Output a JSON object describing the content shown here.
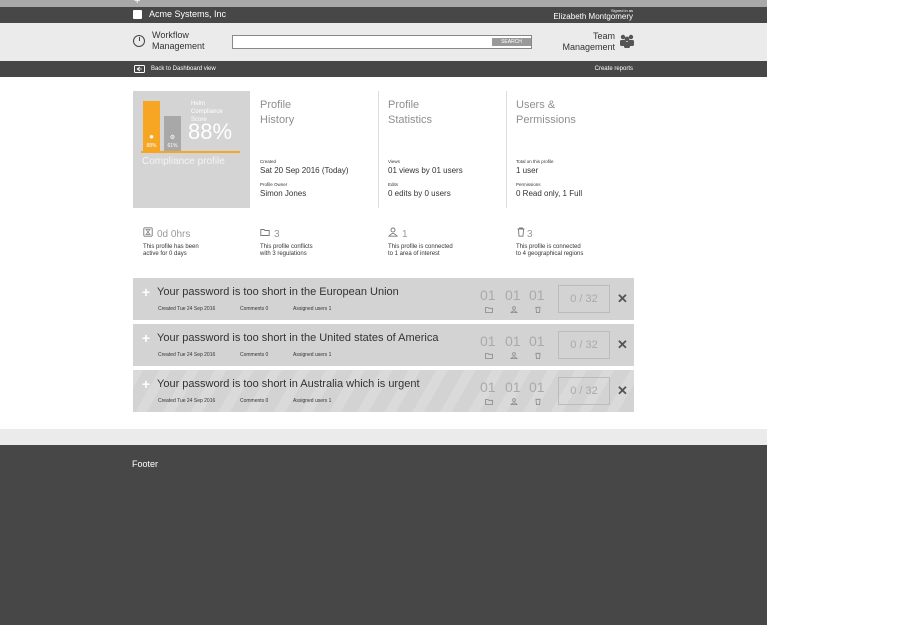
{
  "header": {
    "company": "Acme Systems, Inc",
    "signed_in_label": "Signed in as",
    "user_name": "Elizabeth Montgomery"
  },
  "nav": {
    "workflow_line1": "Workflow",
    "workflow_line2": "Management",
    "search_value": "",
    "search_button": "SEARCH",
    "team_line1": "Team",
    "team_line2": "Management"
  },
  "subnav": {
    "back_label": "Back to Dashboard view",
    "create_label": "Create reports"
  },
  "score": {
    "label": "Helm Compliance Score",
    "value": "88%",
    "bar1_label": "88%",
    "bar1_value": 88,
    "bar2_label": "61%",
    "bar2_value": 61,
    "profile_label": "Compliance profile"
  },
  "columns": [
    {
      "title_line1": "Profile",
      "title_line2": "History",
      "field1_label": "Created",
      "field1_value": "Sat 20 Sep 2016 (Today)",
      "field2_label": "Profile Owner",
      "field2_value": "Simon Jones"
    },
    {
      "title_line1": "Profile",
      "title_line2": "Statistics",
      "field1_label": "Views",
      "field1_value": "01 views by 01 users",
      "field2_label": "Edits",
      "field2_value": "0 edits by 0 users"
    },
    {
      "title_line1": "Users &",
      "title_line2": "Permissions",
      "field1_label": "Total on this profile",
      "field1_value": "1 user",
      "field2_label": "Permissions",
      "field2_value": "0 Read only, 1 Full"
    }
  ],
  "stats": [
    {
      "icon": "hourglass-icon",
      "value": "0d 0hrs",
      "desc_line1": "This profile has been",
      "desc_line2": "active for 0 days"
    },
    {
      "icon": "folder-icon",
      "value": "3",
      "desc_line1": "This profile conflicts",
      "desc_line2": "with 3 regulations"
    },
    {
      "icon": "user-icon",
      "value": "1",
      "desc_line1": "This profile is connected",
      "desc_line2": "to 1 area of interest"
    },
    {
      "icon": "trash-icon",
      "value": "3",
      "desc_line1": "This profile is connected",
      "desc_line2": "to 4 geographical regions"
    }
  ],
  "alerts": [
    {
      "title": "Your password is too short in the European Union",
      "created": "Created Tue 24 Sep 2016",
      "comments": "Comments 0",
      "assigned": "Assigned users 1",
      "count1": "01",
      "count2": "01",
      "count3": "01",
      "progress": "0 / 32"
    },
    {
      "title": "Your password is too short in the United states of America",
      "created": "Created Tue 24 Sep 2016",
      "comments": "Comments 0",
      "assigned": "Assigned users 1",
      "count1": "01",
      "count2": "01",
      "count3": "01",
      "progress": "0 / 32"
    },
    {
      "title": "Your password is too short in Australia which is urgent",
      "created": "Created Tue 24 Sep 2016",
      "comments": "Comments 0",
      "assigned": "Assigned users 1",
      "count1": "01",
      "count2": "01",
      "count3": "01",
      "progress": "0 / 32"
    }
  ],
  "footer": {
    "label": "Footer"
  },
  "colors": {
    "accent": "#f6a623",
    "dark_bar": "#474747",
    "light_bar": "#ebebeb",
    "card": "#d3d3d3"
  }
}
